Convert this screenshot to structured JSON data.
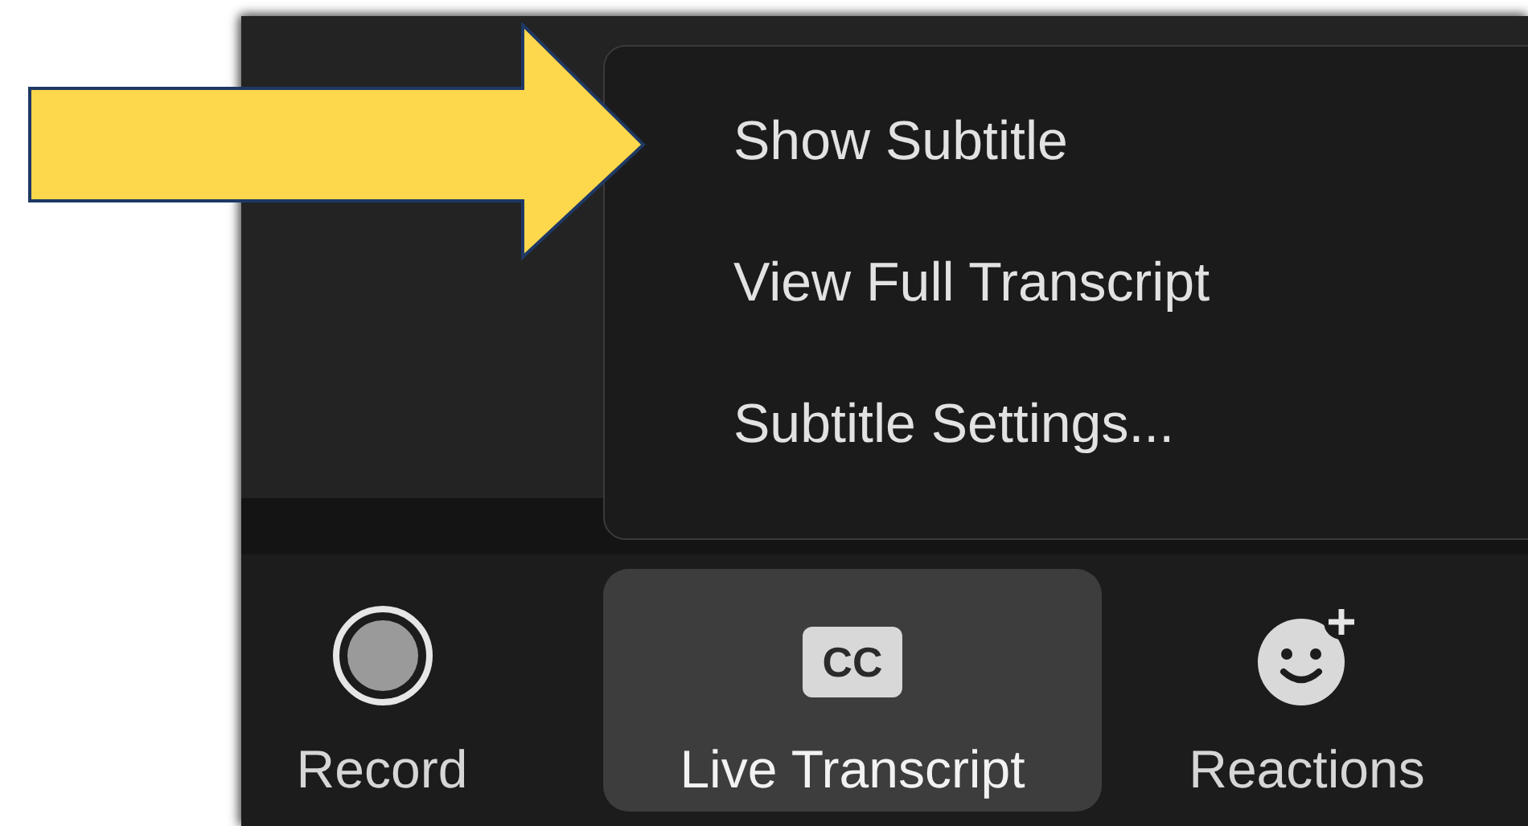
{
  "menu": {
    "items": [
      {
        "label": "Show Subtitle"
      },
      {
        "label": "View Full Transcript"
      },
      {
        "label": "Subtitle Settings..."
      }
    ]
  },
  "toolbar": {
    "buttons": [
      {
        "kind": "record",
        "label": "Record",
        "selected": false
      },
      {
        "kind": "captions",
        "label": "Live Transcript",
        "badge": "CC",
        "selected": true
      },
      {
        "kind": "reactions",
        "label": "Reactions",
        "selected": false
      }
    ]
  }
}
